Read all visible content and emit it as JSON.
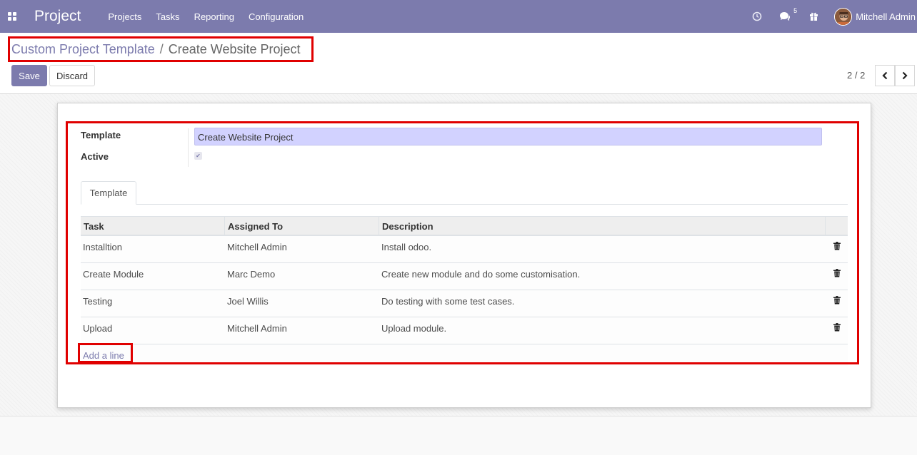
{
  "navbar": {
    "app_name": "Project",
    "menu": [
      "Projects",
      "Tasks",
      "Reporting",
      "Configuration"
    ],
    "chat_badge": "5",
    "user_name": "Mitchell Admin",
    "icons": [
      "apps-icon",
      "clock-icon",
      "chat-icon",
      "gift-icon"
    ]
  },
  "breadcrumb": {
    "parent": "Custom Project Template",
    "separator": "/",
    "current": "Create Website Project"
  },
  "buttons": {
    "save": "Save",
    "discard": "Discard"
  },
  "pager": {
    "value": "2 / 2"
  },
  "form": {
    "template_label": "Template",
    "template_value": "Create Website Project",
    "active_label": "Active",
    "active_checked": true
  },
  "tabs": [
    "Template"
  ],
  "table": {
    "headers": [
      "Task",
      "Assigned To",
      "Description"
    ],
    "rows": [
      {
        "task": "Installtion",
        "assigned": "Mitchell Admin",
        "description": "Install odoo."
      },
      {
        "task": "Create Module",
        "assigned": "Marc Demo",
        "description": "Create new module and do some customisation."
      },
      {
        "task": "Testing",
        "assigned": "Joel Willis",
        "description": "Do testing with some test cases."
      },
      {
        "task": "Upload",
        "assigned": "Mitchell Admin",
        "description": "Upload module."
      }
    ],
    "add_line": "Add a line"
  },
  "colors": {
    "brand": "#7c7bad",
    "highlight": "#e00000",
    "input_bg": "#d2d2ff"
  }
}
